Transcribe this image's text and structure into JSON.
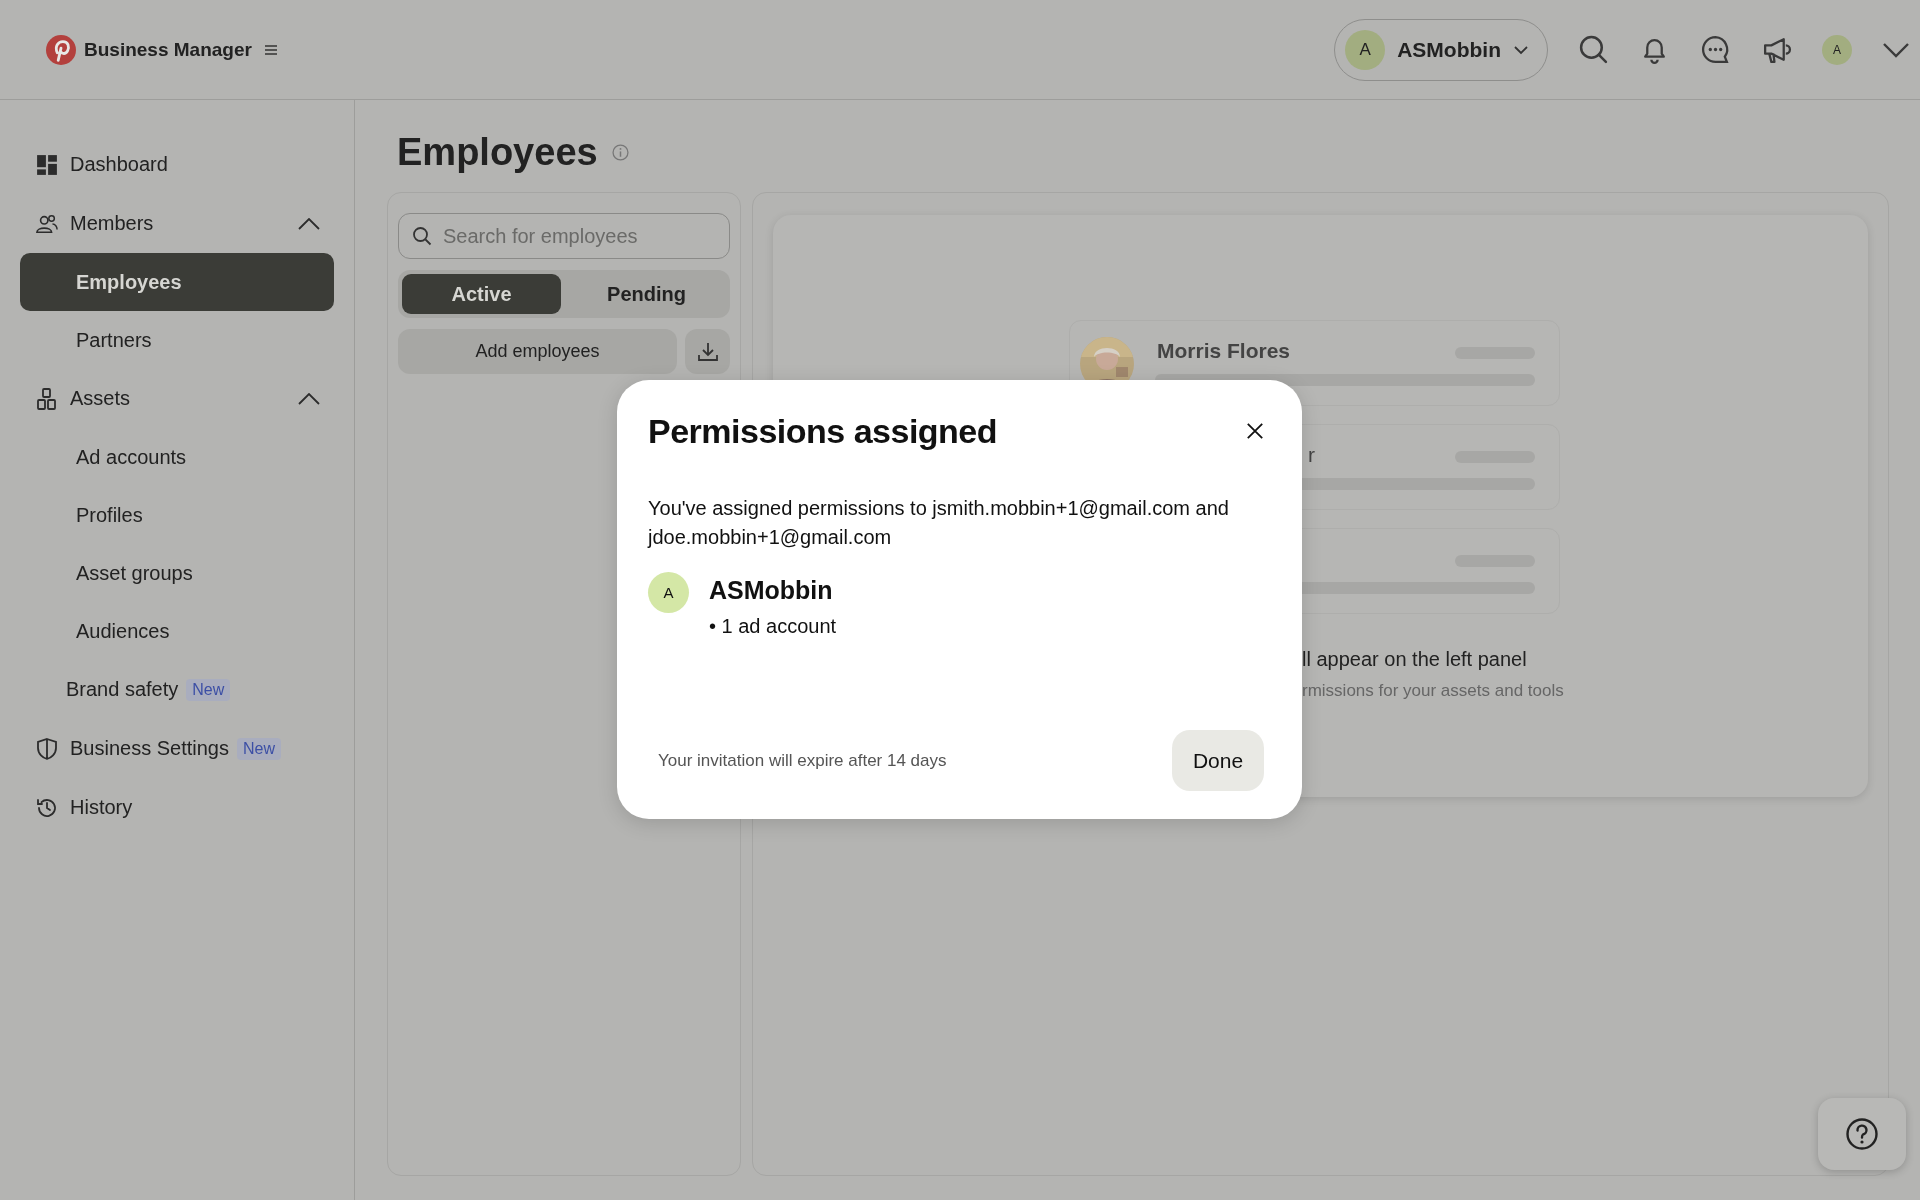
{
  "header": {
    "brand": "Business Manager",
    "account": {
      "initial": "A",
      "name": "ASMobbin"
    },
    "profile_initial": "A"
  },
  "sidebar": {
    "items": [
      {
        "kind": "link",
        "label": "Dashboard",
        "selected": false
      },
      {
        "kind": "group",
        "label": "Members",
        "expanded": true,
        "children": [
          {
            "label": "Employees",
            "selected": true
          },
          {
            "label": "Partners",
            "selected": false
          }
        ]
      },
      {
        "kind": "group",
        "label": "Assets",
        "expanded": true,
        "children": [
          {
            "label": "Ad accounts",
            "selected": false
          },
          {
            "label": "Profiles",
            "selected": false
          },
          {
            "label": "Asset groups",
            "selected": false
          },
          {
            "label": "Audiences",
            "selected": false
          }
        ]
      },
      {
        "kind": "plain",
        "label": "Brand safety",
        "badge": "New",
        "selected": false
      },
      {
        "kind": "link",
        "label": "Business Settings",
        "badge": "New",
        "selected": false
      },
      {
        "kind": "link",
        "label": "History",
        "selected": false
      }
    ]
  },
  "page": {
    "title": "Employees",
    "search": {
      "placeholder": "Search for employees"
    },
    "tabs": [
      {
        "label": "Active",
        "selected": true
      },
      {
        "label": "Pending",
        "selected": false
      }
    ],
    "add_button": "Add employees"
  },
  "preview": {
    "person_name": "Morris Flores",
    "fragment": "r",
    "message": "ll appear on the left panel",
    "submessage": "rmissions for your assets and tools"
  },
  "modal": {
    "title": "Permissions assigned",
    "body": "You've assigned permissions to jsmith.mobbin+1@gmail.com and jdoe.mobbin+1@gmail.com",
    "account": {
      "initial": "A",
      "name": "ASMobbin",
      "detail": "• 1 ad account"
    },
    "note": "Your invitation will expire after 14 days",
    "done": "Done"
  }
}
